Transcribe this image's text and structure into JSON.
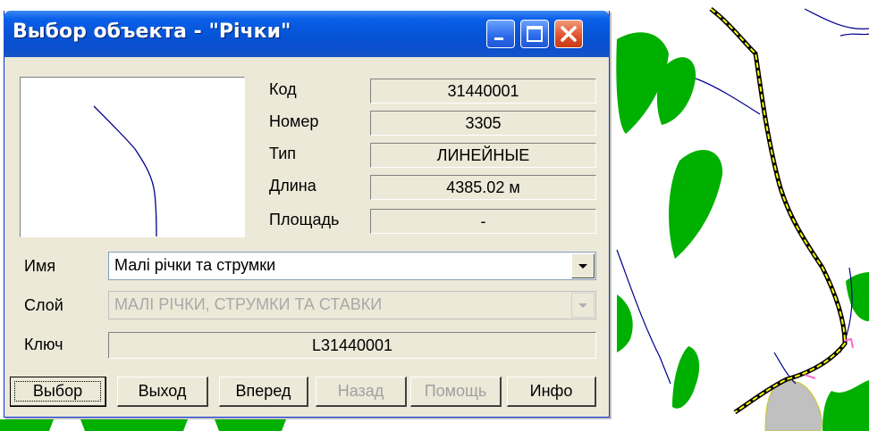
{
  "window": {
    "title": "Выбор объекта - \"Річки\""
  },
  "properties": [
    {
      "label": "Код",
      "value": "31440001"
    },
    {
      "label": "Номер",
      "value": "3305"
    },
    {
      "label": "Тип",
      "value": "ЛИНЕЙНЫЕ"
    },
    {
      "label": "Длина",
      "value": "4385.02  м"
    },
    {
      "label": "Площадь",
      "value": "-"
    }
  ],
  "fields": {
    "name": {
      "label": "Имя",
      "value": "Малі річки та струмки"
    },
    "layer": {
      "label": "Слой",
      "value": "МАЛІ РІЧКИ, СТРУМКИ ТА СТАВКИ"
    },
    "key": {
      "label": "Ключ",
      "value": "L31440001"
    }
  },
  "buttons": {
    "select": "Выбор",
    "exit": "Выход",
    "forward": "Вперед",
    "back": "Назад",
    "help": "Помощь",
    "info": "Инфо"
  },
  "colors": {
    "title_bar": "#0553d6",
    "forest": "#00b000",
    "river": "#00008b",
    "road": "#ffff00",
    "gray_area": "#c0c0c0"
  },
  "icons": [
    "minimize-icon",
    "maximize-icon",
    "close-icon",
    "chevron-down-icon"
  ]
}
